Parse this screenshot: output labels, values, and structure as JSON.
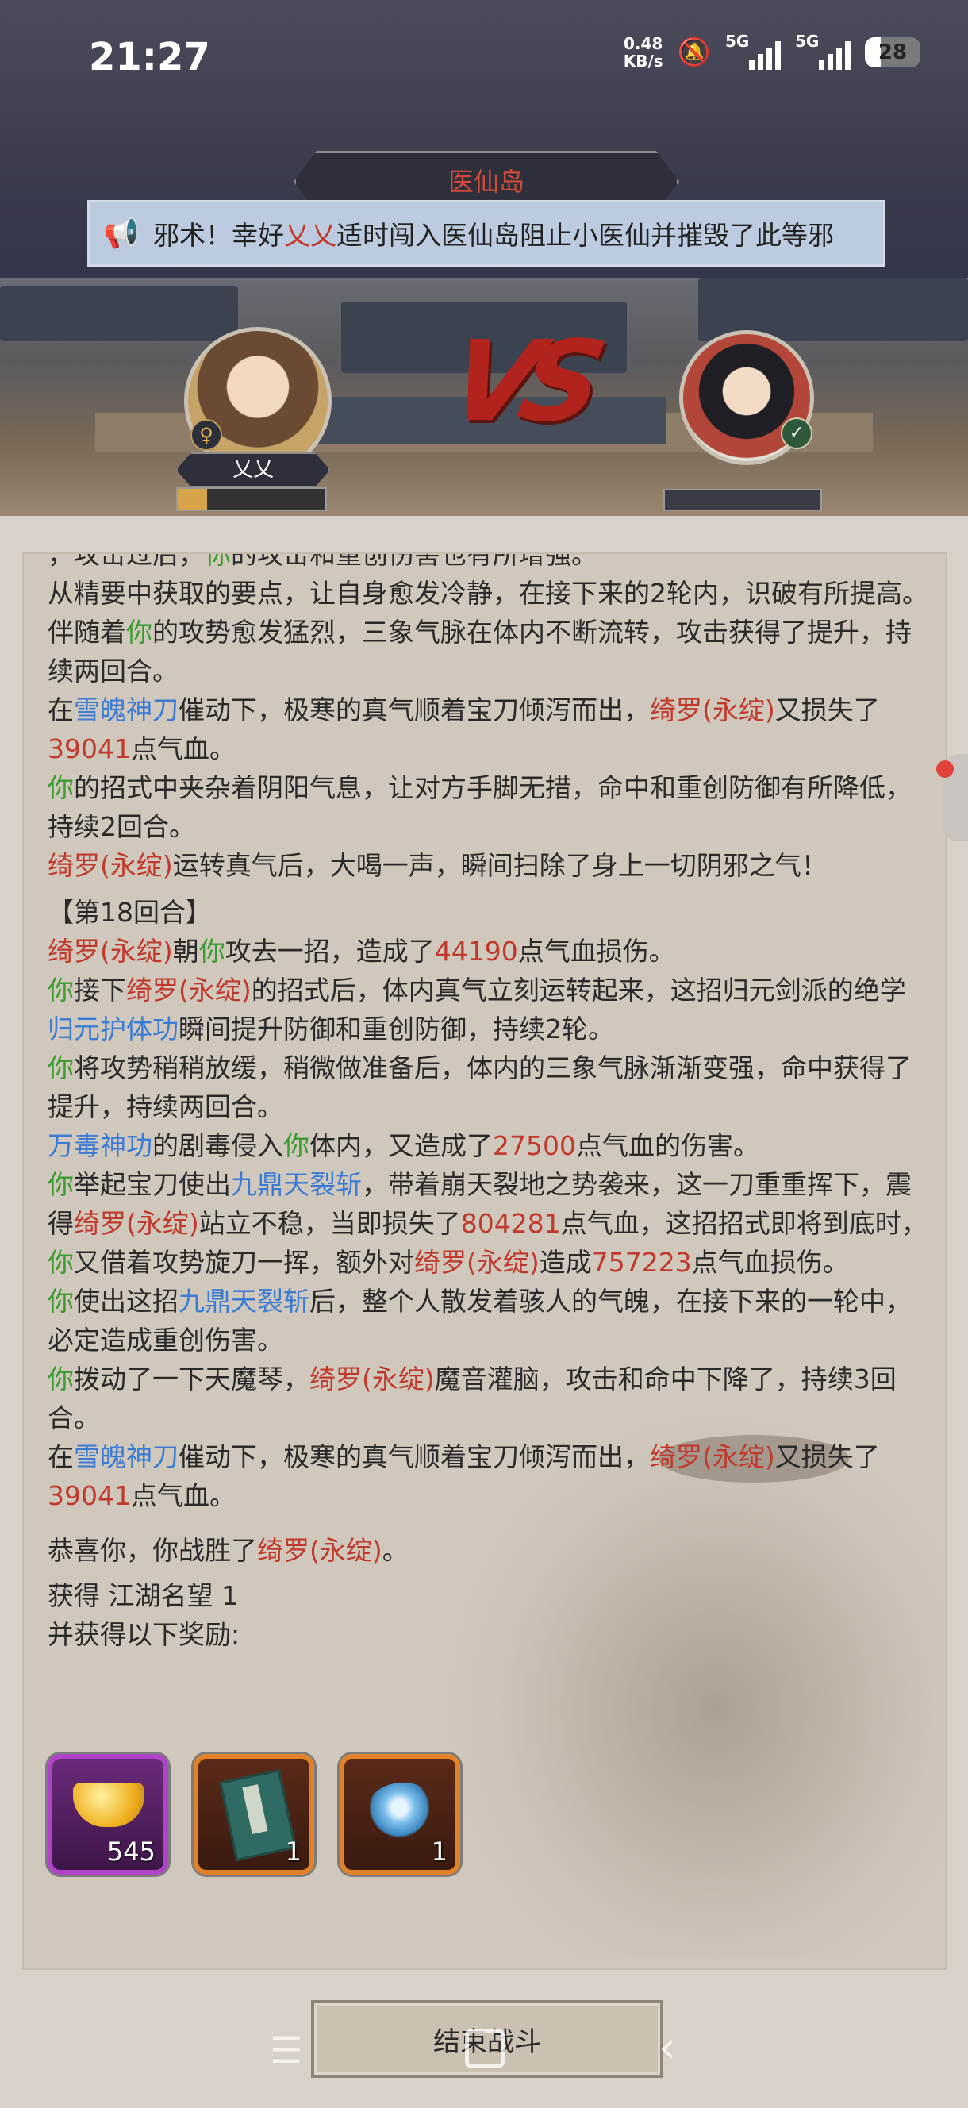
{
  "status_bar": {
    "time": "21:27",
    "speed_value": "0.48",
    "speed_unit": "KB/s",
    "sim1": "5G",
    "sim2": "5G",
    "battery": "28"
  },
  "header": {
    "location": "医仙岛",
    "notice_prefix": "邪术！幸好",
    "notice_player": "乂乂",
    "notice_suffix": "适时闯入医仙岛阻止小医仙并摧毁了此等邪"
  },
  "battle": {
    "player_name": "乂乂",
    "player_gender": "♀",
    "player_hp_fraction": 0.2,
    "enemy_rank_icon": "rank-icon",
    "vs": "VS"
  },
  "log": {
    "l0a": "，攻击过后，",
    "l0b": "你",
    "l0c": "的攻击和重创伤害也有所增强。",
    "l1": "从精要中获取的要点，让自身愈发冷静，在接下来的2轮内，识破有所提高。",
    "l2a": "伴随着",
    "l2b": "你",
    "l2c": "的攻势愈发猛烈，三象气脉在体内不断流转，攻击获得了提升，持续两回合。",
    "l3a": "在",
    "l3b": "雪魄神刀",
    "l3c": "催动下，极寒的真气顺着宝刀倾泻而出，",
    "l3d": "绮罗(永绽)",
    "l3e": "又损失了",
    "l3f": "39041",
    "l3g": "点气血。",
    "l4a": "你",
    "l4b": "的招式中夹杂着阴阳气息，让对方手脚无措，命中和重创防御有所降低，持续2回合。",
    "l5a": "绮罗(永绽)",
    "l5b": "运转真气后，大喝一声，瞬间扫除了身上一切阴邪之气！",
    "round": "【第18回合】",
    "l6a": "绮罗(永绽)",
    "l6b": "朝",
    "l6c": "你",
    "l6d": "攻去一招，造成了",
    "l6e": "44190",
    "l6f": "点气血损伤。",
    "l7a": "你",
    "l7b": "接下",
    "l7c": "绮罗(永绽)",
    "l7d": "的招式后，体内真气立刻运转起来，这招归元剑派的绝学",
    "l7e": "归元护体功",
    "l7f": "瞬间提升防御和重创防御，持续2轮。",
    "l8a": "你",
    "l8b": "将攻势稍稍放缓，稍微做准备后，体内的三象气脉渐渐变强，命中获得了提升，持续两回合。",
    "l9a": "万毒神功",
    "l9b": "的剧毒侵入",
    "l9c": "你",
    "l9d": "体内，又造成了",
    "l9e": "27500",
    "l9f": "点气血的伤害。",
    "l10a": "你",
    "l10b": "举起宝刀使出",
    "l10c": "九鼎天裂斩",
    "l10d": "，带着崩天裂地之势袭来，这一刀重重挥下，震得",
    "l10e": "绮罗(永绽)",
    "l10f": "站立不稳，当即损失了",
    "l10g": "804281",
    "l10h": "点气血，这招招式即将到底时，",
    "l10i": "你",
    "l10j": "又借着攻势旋刀一挥，额外对",
    "l10k": "绮罗(永绽)",
    "l10l": "造成",
    "l10m": "757223",
    "l10n": "点气血损伤。",
    "l11a": "你",
    "l11b": "使出这招",
    "l11c": "九鼎天裂斩",
    "l11d": "后，整个人散发着骇人的气魄，在接下来的一轮中，必定造成重创伤害。",
    "l12a": "你",
    "l12b": "拨动了一下天魔琴，",
    "l12c": "绮罗(永绽)",
    "l12d": "魔音灌脑，攻击和命中下降了，持续3回合。",
    "l13a": "在",
    "l13b": "雪魄神刀",
    "l13c": "催动下，极寒的真气顺着宝刀倾泻而出，",
    "l13d": "绮罗(永绽)",
    "l13e": "又损失了",
    "l13f": "39041",
    "l13g": "点气血。"
  },
  "result": {
    "victory_prefix": "恭喜你，你战胜了",
    "victory_enemy": "绮罗(永绽)",
    "victory_suffix": "。",
    "fame": "获得 江湖名望 1",
    "rewards_title": "并获得以下奖励:",
    "rewards": [
      {
        "icon": "gold-ingot-icon",
        "count": "545",
        "rarity": "purple"
      },
      {
        "icon": "skill-book-icon",
        "count": "1",
        "rarity": "orange"
      },
      {
        "icon": "spirit-swirl-icon",
        "count": "1",
        "rarity": "orange"
      }
    ]
  },
  "end_button": "结束战斗",
  "colors": {
    "player_green": "#3a9b2e",
    "enemy_red": "#c0392b",
    "skill_blue": "#3a7bd5"
  }
}
